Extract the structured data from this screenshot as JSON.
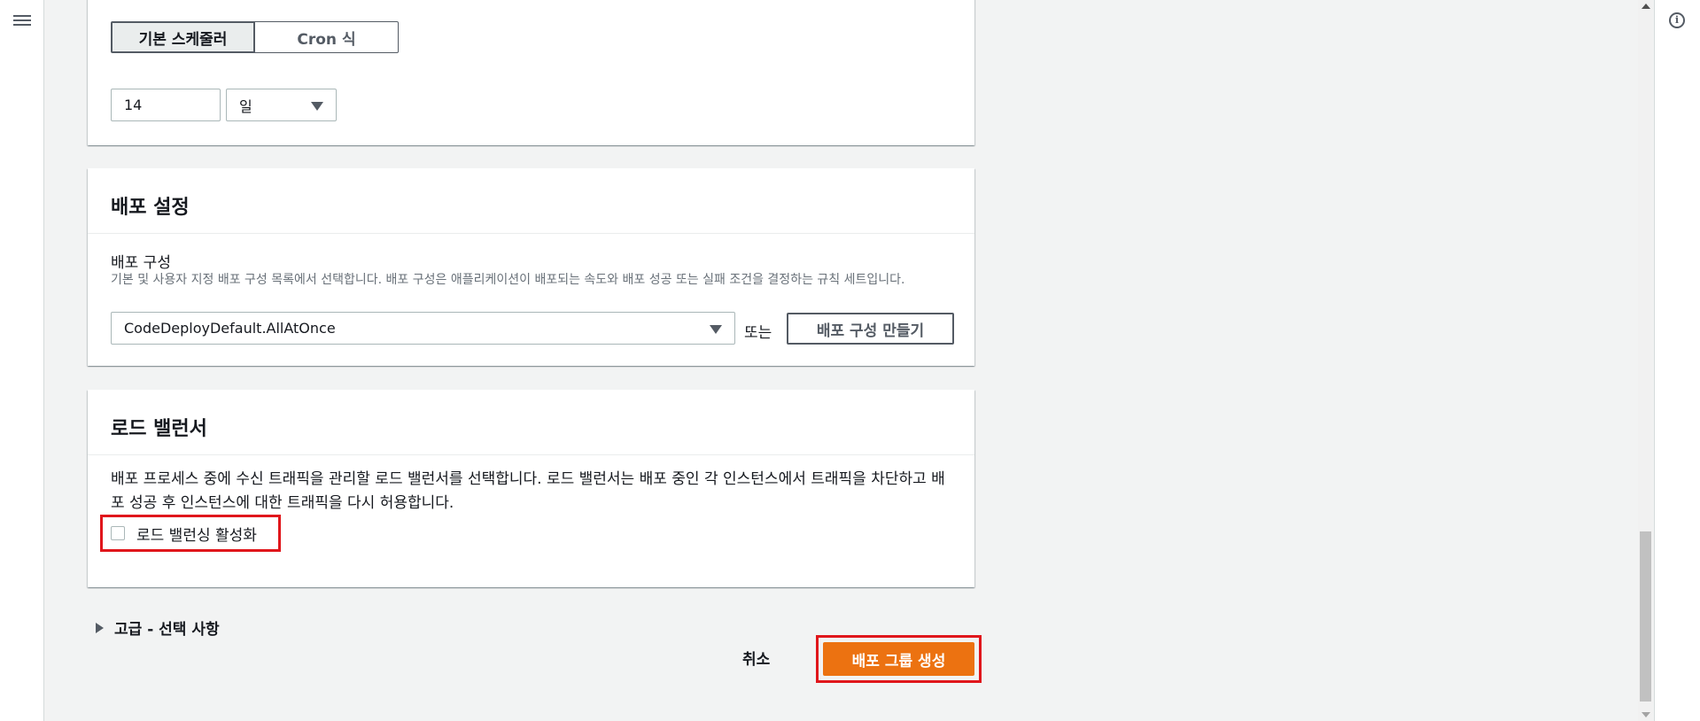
{
  "schedule": {
    "tab_basic": "기본 스케줄러",
    "tab_cron": "Cron 식",
    "interval_value": "14",
    "interval_unit": "일"
  },
  "deploy_settings": {
    "title": "배포 설정",
    "config_label": "배포 구성",
    "config_desc": "기본 및 사용자 지정 배포 구성 목록에서 선택합니다. 배포 구성은 애플리케이션이 배포되는 속도와 배포 성공 또는 실패 조건을 결정하는 규칙 세트입니다.",
    "config_value": "CodeDeployDefault.AllAtOnce",
    "or_text": "또는",
    "create_config_button": "배포 구성 만들기"
  },
  "load_balancer": {
    "title": "로드 밸런서",
    "description": "배포 프로세스 중에 수신 트래픽을 관리할 로드 밸런서를 선택합니다. 로드 밸런서는 배포 중인 각 인스턴스에서 트래픽을 차단하고 배포 성공 후 인스턴스에 대한 트래픽을 다시 허용합니다.",
    "enable_checkbox_label": "로드 밸런싱 활성화",
    "enable_checked": false
  },
  "advanced": {
    "label": "고급 - 선택 사항"
  },
  "footer": {
    "cancel_label": "취소",
    "create_label": "배포 그룹 생성"
  },
  "colors": {
    "primary": "#ec7211",
    "highlight": "#e0161b",
    "background": "#f2f3f3"
  },
  "icons": {
    "menu": "hamburger-menu-icon",
    "info": "info-icon",
    "expand": "caret-right-icon",
    "dropdown": "caret-down-icon"
  }
}
